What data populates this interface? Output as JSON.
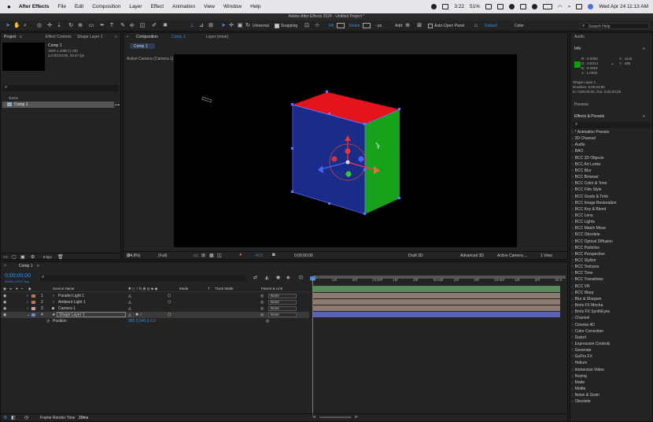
{
  "menubar": {
    "app_name": "After Effects",
    "menus": [
      "File",
      "Edit",
      "Composition",
      "Layer",
      "Effect",
      "Animation",
      "View",
      "Window",
      "Help"
    ],
    "time_indicator": "3:22",
    "battery": "51%",
    "datetime": "Wed Apr 24  11:13 AM"
  },
  "window": {
    "title": "Adobe After Effects 2024 - Untitled Project *"
  },
  "toolbar": {
    "universal_label": "Universal",
    "snapping_label": "Snapping",
    "fill_label": "Fill",
    "stroke_label": "Stroke",
    "px_label": "- px",
    "add_label": "Add:",
    "auto_open_label": "Auto-Open Panel",
    "workspace_default": "Default",
    "workspace_color": "Color",
    "search_help_placeholder": "Search Help"
  },
  "project_panel": {
    "tab_project": "Project",
    "tab_effect_controls": "Effect Controls",
    "effect_controls_target": "Shape Layer 1",
    "comp_name": "Comp 1",
    "comp_dims": "1920 x 1080 (1.00)",
    "comp_duration": "Δ 0;00;04;00, 29.97 fps",
    "name_header": "Name",
    "items": [
      "Comp 1"
    ],
    "bpc_label": "8 bpc"
  },
  "composition_panel": {
    "tab_label": "Composition",
    "comp_tab_name": "Comp 1",
    "layer_tab": "Layer (none)",
    "breadcrumb": "Comp 1",
    "active_camera": "Active Camera (Camera 1)",
    "zoom": "(94.8%)",
    "resolution": "(Full)",
    "exposure": "+0.0",
    "timecode": "0;00;00;00",
    "renderer_draft": "Draft 3D",
    "renderer": "Advanced 3D",
    "view_camera": "Active Camera ...",
    "views": "1 View"
  },
  "info_panel": {
    "title": "Audio",
    "info_title": "Info",
    "r": "R : 0.0000",
    "g": "G : 0.6314",
    "b": "B : 0.0353",
    "a": "A : 1.0000",
    "x": "X : 1143",
    "y": "Y : 485",
    "layer_name": "Shape Layer 1",
    "duration": "Duration: 0;00;04;00",
    "in_out": "In: 0;00;00;00, Out: 0;00;03;29",
    "preview": "Preview"
  },
  "effects_panel": {
    "title": "Effects & Presets",
    "items": [
      "* Animation Presets",
      "3D Channel",
      "Audio",
      "BAO",
      "BCC 3D Objects",
      "BCC Art Looks",
      "BCC Blur",
      "BCC Browser",
      "BCC Color & Tone",
      "BCC Film Style",
      "BCC Grads & Tints",
      "BCC Image Restoration",
      "BCC Key & Blend",
      "BCC Lens",
      "BCC Lights",
      "BCC Match Move",
      "BCC Obsolete",
      "BCC Optical Diffusion",
      "BCC Particles",
      "BCC Perspective",
      "BCC Stylize",
      "BCC Textures",
      "BCC Time",
      "BCC Transitions",
      "BCC VR",
      "BCC Warp",
      "Blur & Sharpen",
      "Boris FX Mocha",
      "Boris FX SynthEyes",
      "Channel",
      "Cinema 4D",
      "Color Correction",
      "Distort",
      "Expression Controls",
      "Generate",
      "GoPro FX",
      "Helium",
      "Immersive Video",
      "Keying",
      "Matte",
      "Mettle",
      "Noise & Grain",
      "Obsolete"
    ]
  },
  "timeline": {
    "tab": "Comp 1",
    "timecode": "0;00;00;00",
    "fps_note": "00000 (29.97 fps)",
    "headers": {
      "source_name": "Source Name",
      "mode": "Mode",
      "t": "T",
      "track_matte": "Track Matte",
      "parent": "Parent & Link"
    },
    "layers": [
      {
        "num": "1",
        "name": "Parallel Light 1",
        "parent": "None",
        "color": "#b47a55"
      },
      {
        "num": "2",
        "name": "Ambient Light 1",
        "parent": "None",
        "color": "#b47a55"
      },
      {
        "num": "3",
        "name": "Camera 1",
        "parent": "None",
        "color": "#c9a0a0"
      },
      {
        "num": "4",
        "name": "Shape Layer 1",
        "parent": "None",
        "color": "#7b83c9"
      }
    ],
    "position_label": "Position",
    "position_value": "960.0,540.0,0.0",
    "ruler": [
      "0f",
      "10f",
      "20f",
      "01:00f",
      "10f",
      "20f",
      "02:00f",
      "10f",
      "20f",
      "03:00f",
      "10f",
      "20f",
      "04:0"
    ],
    "frame_render_label": "Frame Render Time",
    "frame_render_value": "20ms"
  },
  "colors": {
    "accent": "#3d8bd9",
    "cube_top": "#e3141b",
    "cube_right": "#16a319",
    "cube_front": "#1b2b88"
  }
}
